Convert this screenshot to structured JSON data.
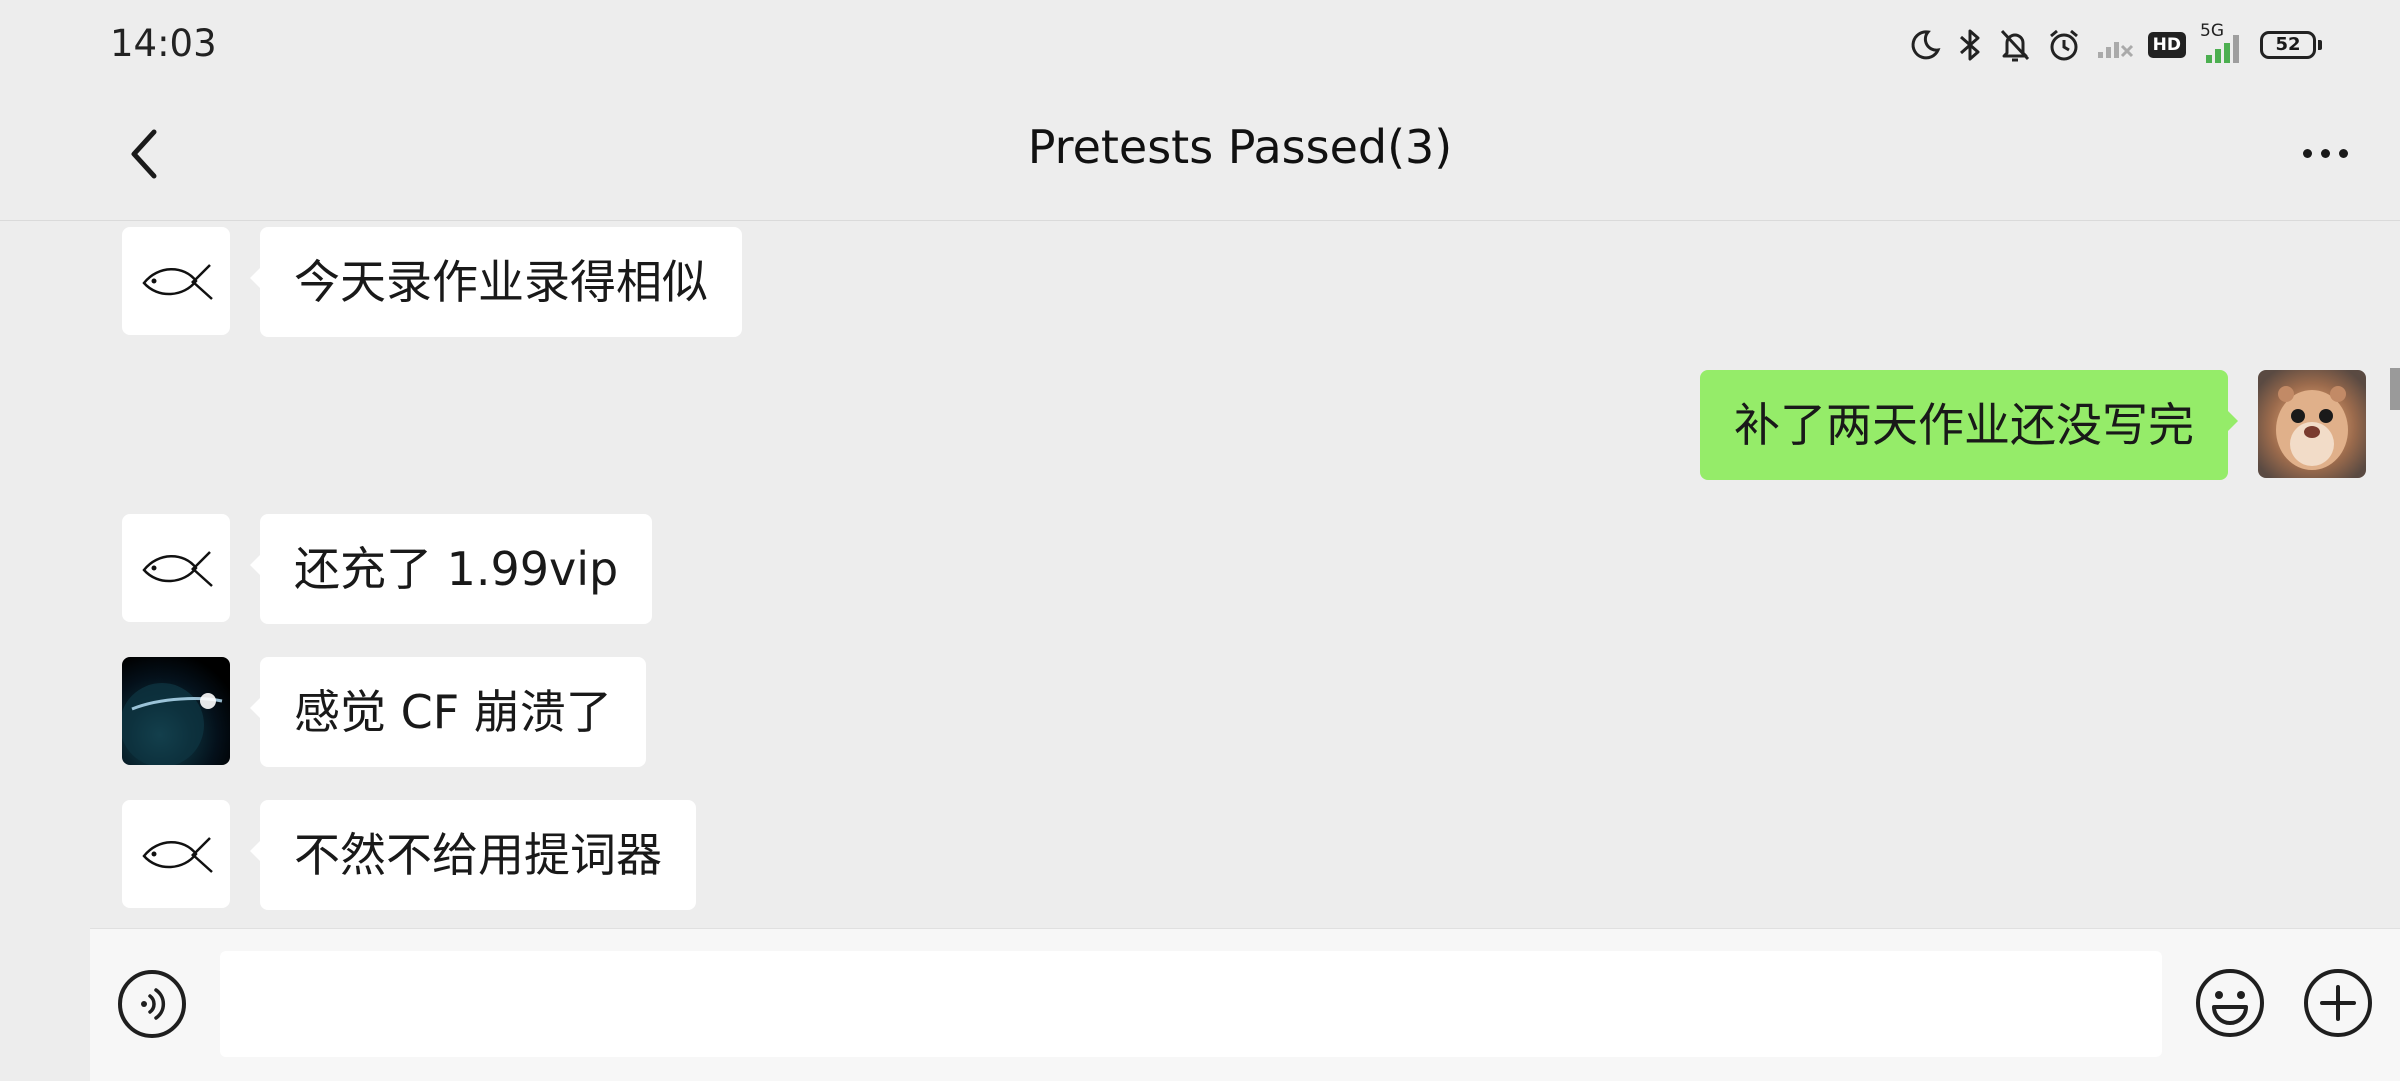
{
  "status_bar": {
    "time": "14:03",
    "network_type": "5G",
    "hd_label": "HD",
    "battery_level": "52",
    "icons": [
      "moon-icon",
      "bluetooth-icon",
      "bell-muted-icon",
      "alarm-icon",
      "signal-weak-icon",
      "hd-badge-icon",
      "signal-5g-icon",
      "battery-icon"
    ]
  },
  "header": {
    "title": "Pretests Passed(3)",
    "back_icon": "chevron-left-icon",
    "more_icon": "more-dots-icon"
  },
  "messages": [
    {
      "side": "left",
      "avatar": "fish-line-avatar",
      "text": "今天录作业录得相似"
    },
    {
      "side": "right",
      "avatar": "hamster-avatar",
      "text": "补了两天作业还没写完"
    },
    {
      "side": "left",
      "avatar": "fish-line-avatar",
      "text": "还充了 1.99vip"
    },
    {
      "side": "left",
      "avatar": "planet-avatar",
      "text": "感觉 CF 崩溃了"
    },
    {
      "side": "left",
      "avatar": "fish-line-avatar",
      "text": "不然不给用提词器"
    }
  ],
  "input_bar": {
    "placeholder": "",
    "value": "",
    "voice_icon": "voice-icon",
    "emoji_icon": "emoji-icon",
    "plus_icon": "plus-icon"
  },
  "colors": {
    "background": "#ededed",
    "bubble_left": "#ffffff",
    "bubble_right": "#95ec69",
    "input_bar": "#f7f7f7"
  }
}
